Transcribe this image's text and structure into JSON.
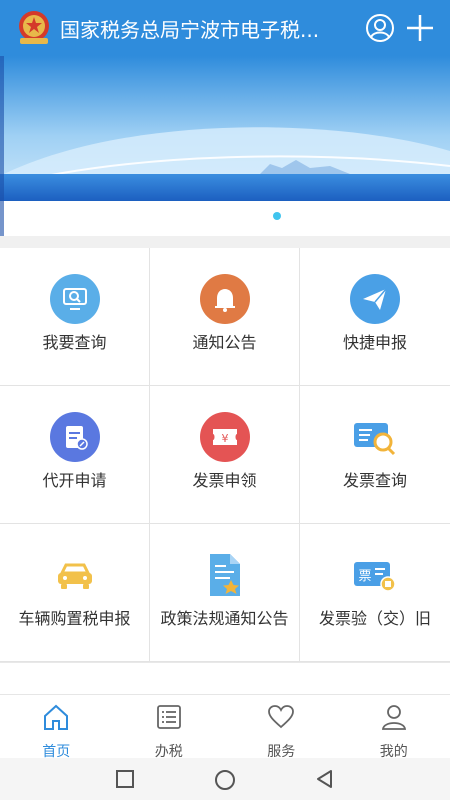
{
  "header": {
    "title": "国家税务总局宁波市电子税..."
  },
  "grid": {
    "items": [
      {
        "label": "我要查询",
        "icon": "monitor-search-icon",
        "color": "#5aaee8"
      },
      {
        "label": "通知公告",
        "icon": "bell-icon",
        "color": "#e07a44"
      },
      {
        "label": "快捷申报",
        "icon": "paper-plane-icon",
        "color": "#4aa0e6"
      },
      {
        "label": "代开申请",
        "icon": "document-edit-icon",
        "color": "#5a78e0"
      },
      {
        "label": "发票申领",
        "icon": "invoice-ticket-icon",
        "color": "#e45454"
      },
      {
        "label": "发票查询",
        "icon": "invoice-search-icon",
        "color": "#4a9fe6"
      },
      {
        "label": "车辆购置税申报",
        "icon": "car-icon",
        "color": "#f2c14a"
      },
      {
        "label": "政策法规通知公告",
        "icon": "policy-document-icon",
        "color": "#5aaee8"
      },
      {
        "label": "发票验（交）旧",
        "icon": "invoice-verify-icon",
        "color": "#4a9fe6"
      }
    ]
  },
  "tabbar": {
    "tabs": [
      {
        "label": "首页",
        "icon": "home-icon",
        "active": true
      },
      {
        "label": "办税",
        "icon": "list-icon",
        "active": false
      },
      {
        "label": "服务",
        "icon": "heart-icon",
        "active": false
      },
      {
        "label": "我的",
        "icon": "user-icon",
        "active": false
      }
    ]
  },
  "colors": {
    "primary": "#2f8cdc",
    "active_tab": "#2f8cdc",
    "carousel_dot": "#40c4ee"
  }
}
